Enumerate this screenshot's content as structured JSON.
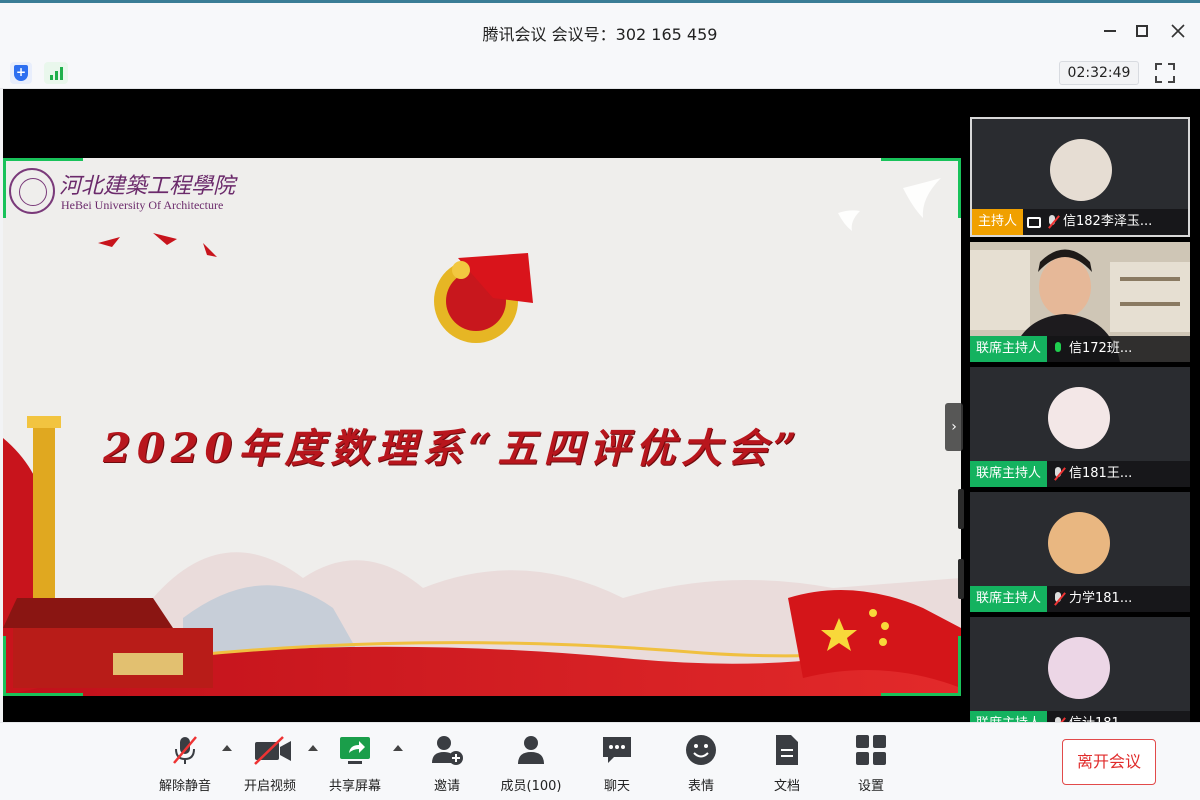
{
  "window": {
    "title": "腾讯会议 会议号：302 165 459"
  },
  "infobar": {
    "timer": "02:32:49"
  },
  "slide": {
    "university_cn": "河北建築工程學院",
    "university_en": "HeBei University Of Architecture",
    "title": "2020年度数理系“五四评优大会”"
  },
  "participants": [
    {
      "role": "主持人",
      "role_type": "host",
      "name": "信182李泽玉...",
      "mic": "off",
      "sharing": true,
      "avatar_color": "#e6ddd3"
    },
    {
      "role": "联席主持人",
      "role_type": "cohost",
      "name": "信172班...",
      "mic": "on",
      "sharing": false,
      "video": true
    },
    {
      "role": "联席主持人",
      "role_type": "cohost",
      "name": "信181王...",
      "mic": "off",
      "sharing": false,
      "avatar_color": "#f3e7e7"
    },
    {
      "role": "联席主持人",
      "role_type": "cohost",
      "name": "力学181...",
      "mic": "off",
      "sharing": false,
      "avatar_color": "#e9b781"
    },
    {
      "role": "联席主持人",
      "role_type": "cohost",
      "name": "信计181...",
      "mic": "off",
      "sharing": false,
      "avatar_color": "#ecd6e6"
    }
  ],
  "toolbar": {
    "unmute": "解除静音",
    "start_video": "开启视频",
    "share_screen": "共享屏幕",
    "invite": "邀请",
    "members": "成员(100)",
    "chat": "聊天",
    "emoji": "表情",
    "docs": "文档",
    "settings": "设置",
    "leave": "离开会议"
  },
  "colors": {
    "host_badge": "#f0a000",
    "cohost_badge": "#14b25f",
    "leave_red": "#e02b2b",
    "slide_title_red": "#b8161d"
  }
}
